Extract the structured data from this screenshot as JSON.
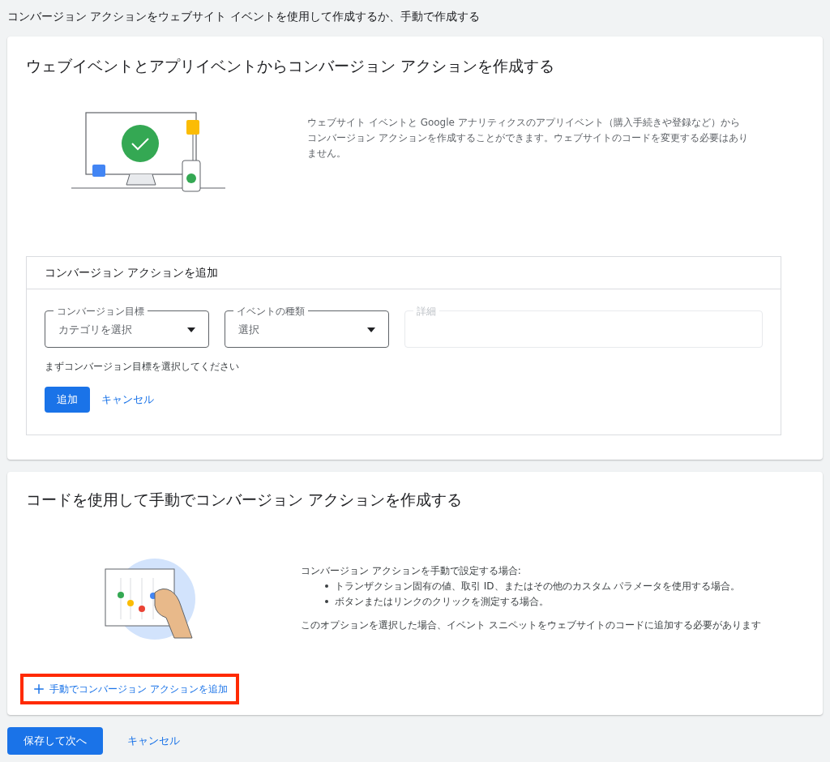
{
  "page_title": "コンバージョン アクションをウェブサイト イベントを使用して作成するか、手動で作成する",
  "auto_section": {
    "title": "ウェブイベントとアプリイベントからコンバージョン アクションを作成する",
    "description": "ウェブサイト イベントと Google アナリティクスのアプリイベント（購入手続きや登録など）からコンバージョン アクションを作成することができます。ウェブサイトのコードを変更する必要はありません。",
    "form": {
      "title": "コンバージョン アクションを追加",
      "fields": [
        {
          "kind": "select",
          "label": "コンバージョン目標",
          "value": "カテゴリを選択",
          "disabled": false
        },
        {
          "kind": "select",
          "label": "イベントの種類",
          "value": "選択",
          "disabled": false
        },
        {
          "kind": "text",
          "label": "詳細",
          "disabled": true
        }
      ],
      "hint": "まずコンバージョン目標を選択してください",
      "add_button": "追加",
      "cancel_link": "キャンセル"
    }
  },
  "manual_section": {
    "title": "コードを使用して手動でコンバージョン アクションを作成する",
    "intro": "コンバージョン アクションを手動で設定する場合:",
    "bullets": [
      "トランザクション固有の値、取引 ID、またはその他のカスタム パラメータを使用する場合。",
      "ボタンまたはリンクのクリックを測定する場合。"
    ],
    "note": "このオプションを選択した場合、イベント スニペットをウェブサイトのコードに追加する必要があります",
    "add_link": "手動でコンバージョン アクションを追加",
    "highlighted": true
  },
  "footer": {
    "save_button": "保存して次へ",
    "cancel_link": "キャンセル"
  }
}
